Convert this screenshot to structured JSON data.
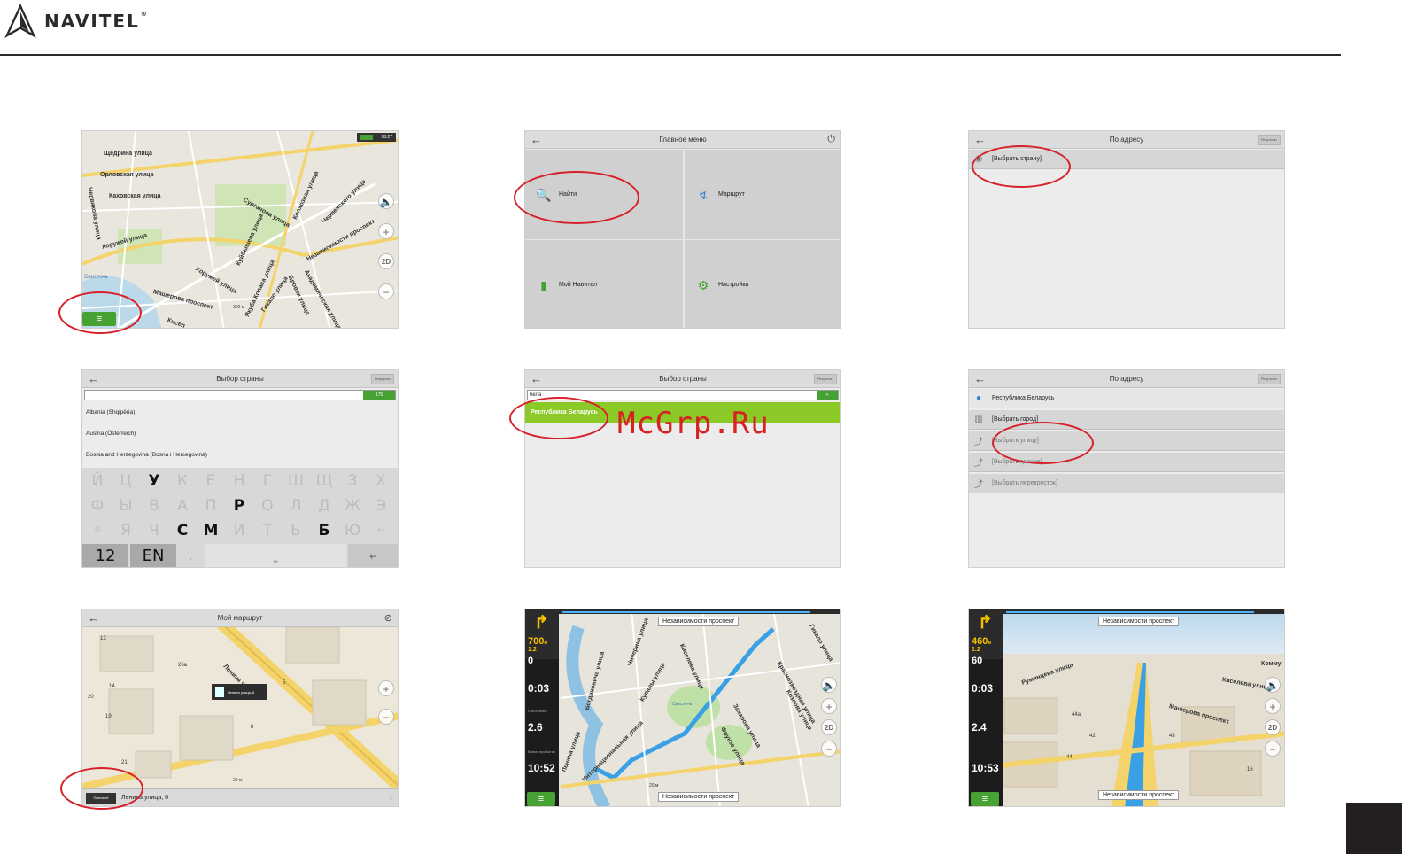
{
  "brand": {
    "name": "NAVITEL",
    "reg": "®"
  },
  "watermark": "McGrp.Ru",
  "shot1": {
    "time": "18:27",
    "streets": [
      "Щедрина улица",
      "Орловская улица",
      "Каховская улица",
      "Хоружей улица",
      "Хоружей улица",
      "Машерова проспект",
      "Сурганова улица",
      "Куйбышева улица",
      "Колхозная улица",
      "Независимости проспект",
      "Академическая улица",
      "Бровки улица",
      "Гикало улица",
      "Кисел",
      "Якуба Коласа улица",
      "Червякова улица",
      "Червенского улица",
      "Свислочь"
    ],
    "scale": "300 м",
    "zoom2d": "2D"
  },
  "shot2": {
    "title": "Главное меню",
    "items": [
      "Найти",
      "Маршрут",
      "Мой Навител",
      "Настройки"
    ]
  },
  "shot3": {
    "title": "По адресу",
    "right_btn": "Результат",
    "row": "[Выбрать страну]"
  },
  "shot4": {
    "title": "Выбор страны",
    "right_btn": "Результат",
    "counter": "175",
    "list": [
      "Albania (Shqipëria)",
      "Austria (Österreich)",
      "Bosnia and Herzegovina (Bosna i Hercegovina)"
    ],
    "row1": [
      "Й",
      "Ц",
      "У",
      "К",
      "Е",
      "Н",
      "Г",
      "Ш",
      "Щ",
      "З",
      "Х"
    ],
    "row2": [
      "Ф",
      "Ы",
      "В",
      "А",
      "П",
      "Р",
      "О",
      "Л",
      "Д",
      "Ж",
      "Э"
    ],
    "row3": [
      "0",
      "Я",
      "Ч",
      "С",
      "М",
      "И",
      "Т",
      "Ь",
      "Б",
      "Ю",
      "←"
    ],
    "bottom": [
      "12",
      "EN",
      ".",
      "⎵",
      "↵"
    ]
  },
  "shot5": {
    "title": "Выбор страны",
    "right_btn": "Результат",
    "query": "бела",
    "result": "Республика Беларусь"
  },
  "shot6": {
    "title": "По адресу",
    "right_btn": "Результат",
    "rows": [
      "Республика Беларусь",
      "[Выбрать город]",
      "[Выбрать улицу]",
      "[Выбрать здание]",
      "[Выбрать перекресток]"
    ]
  },
  "shot7": {
    "title": "Мой маршрут",
    "popup": "Ленина улица, 6",
    "street": "Ленина улица",
    "go": "Поехали!",
    "address": "Ленина улица, 6",
    "scale": "20 м",
    "numbers": [
      "13",
      "26а",
      "14",
      "20",
      "19",
      "21",
      "8",
      "5"
    ]
  },
  "shot8": {
    "dist": "700",
    "unit": "м",
    "sub": "1.2",
    "speed": "0",
    "time1": "0:03",
    "dist2": "2.6",
    "time2": "10:52",
    "caps": [
      "Осталось",
      "Расстояние",
      "Время прибытия"
    ],
    "top_street": "Независимости проспект",
    "bottom_street": "Независимости проспект",
    "scale": "20 м",
    "streets": [
      "Богдановича улица",
      "Чичерина улица",
      "Купалы улица",
      "Киселева улица",
      "Краснозвездная улица",
      "Козлова улица",
      "Захарова улица",
      "Фрунзе улица",
      "Интернациональная улица",
      "Ленина улица",
      "Гикало улица",
      "Свислочь"
    ]
  },
  "shot9": {
    "dist": "460",
    "sub": "1.2",
    "speed": "60",
    "time1": "0:03",
    "dist2": "2.4",
    "time2": "10:53",
    "top_street": "Независимости проспект",
    "bottom_street": "Независимости проспект",
    "streets": [
      "Румянцева улица",
      "Киселева улица",
      "Машерова проспект",
      "Комму"
    ],
    "numbers": [
      "44а",
      "44",
      "42",
      "43",
      "16"
    ]
  },
  "colors": {
    "accent_green": "#47a234",
    "highlight_green": "#8ac926",
    "red_ring": "#d6212a",
    "route_blue": "#3aa0e6"
  }
}
